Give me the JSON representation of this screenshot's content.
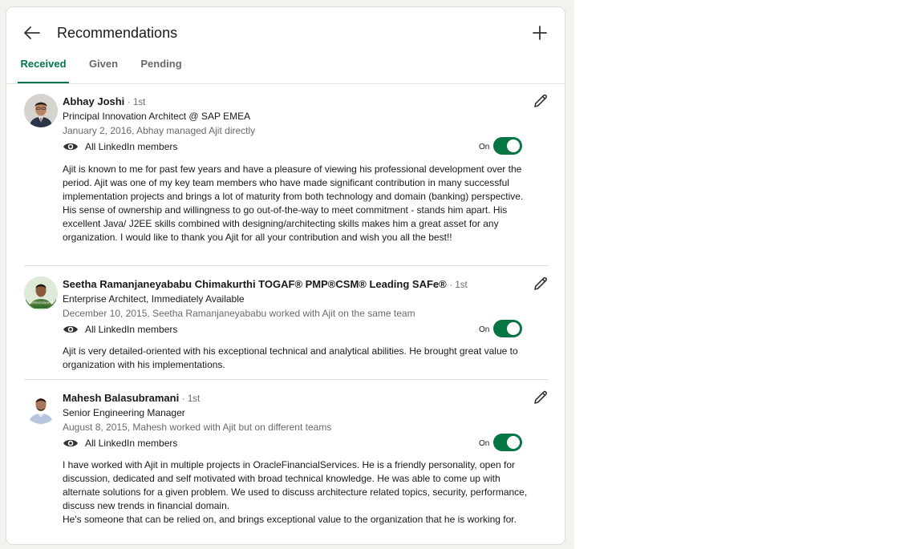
{
  "header": {
    "title": "Recommendations"
  },
  "tabs": [
    {
      "label": "Received",
      "active": true
    },
    {
      "label": "Given",
      "active": false
    },
    {
      "label": "Pending",
      "active": false
    }
  ],
  "recommendations": [
    {
      "name": "Abhay Joshi",
      "degree": "· 1st",
      "headline": "Principal Innovation Architect @ SAP EMEA",
      "meta": "January 2, 2016, Abhay managed Ajit directly",
      "visibility": "All LinkedIn members",
      "toggle_label": "On",
      "toggle_on": true,
      "text": "Ajit is known to me for past few years and have a pleasure of viewing his professional development over the period. Ajit was one of my key team members who have made significant contribution in many successful implementation projects and brings a lot of maturity from both technology and domain (banking) perspective. His sense of ownership and willingness to go out-of-the-way to meet commitment - stands him apart. His excellent Java/ J2EE skills combined with designing/architecting skills makes him a great asset for any organization. I would like to thank you Ajit for all your contribution and wish you all the best!!"
    },
    {
      "name": "Seetha Ramanjaneyababu Chimakurthi TOGAF® PMP®CSM® Leading SAFe®",
      "degree": "· 1st",
      "headline": "Enterprise Architect, Immediately Available",
      "meta": "December 10, 2015, Seetha Ramanjaneyababu worked with Ajit on the same team",
      "visibility": "All LinkedIn members",
      "toggle_label": "On",
      "toggle_on": true,
      "text": "Ajit is very detailed-oriented with his exceptional technical and analytical abilities. He brought great value to organization with his implementations."
    },
    {
      "name": "Mahesh Balasubramani",
      "degree": "· 1st",
      "headline": "Senior Engineering Manager",
      "meta": "August 8, 2015, Mahesh worked with Ajit but on different teams",
      "visibility": "All LinkedIn members",
      "toggle_label": "On",
      "toggle_on": true,
      "text": "I have worked with Ajit in multiple projects in OracleFinancialServices. He is a friendly personality, open for discussion, dedicated and self motivated with broad technical knowledge. He was able to come up with alternate solutions for a given problem. We used to discuss architecture related topics, security, performance, discuss new trends in financial domain.",
      "text2": "He's someone that can be relied on, and brings exceptional value to the organization that he is working for."
    }
  ],
  "icons": {
    "back": "arrow-left-icon",
    "add": "plus-icon",
    "edit": "pencil-icon",
    "visibility": "eye-icon"
  },
  "colors": {
    "accent": "#01754f",
    "toggle_on": "#057642",
    "page_bg": "#f4f2ee"
  }
}
